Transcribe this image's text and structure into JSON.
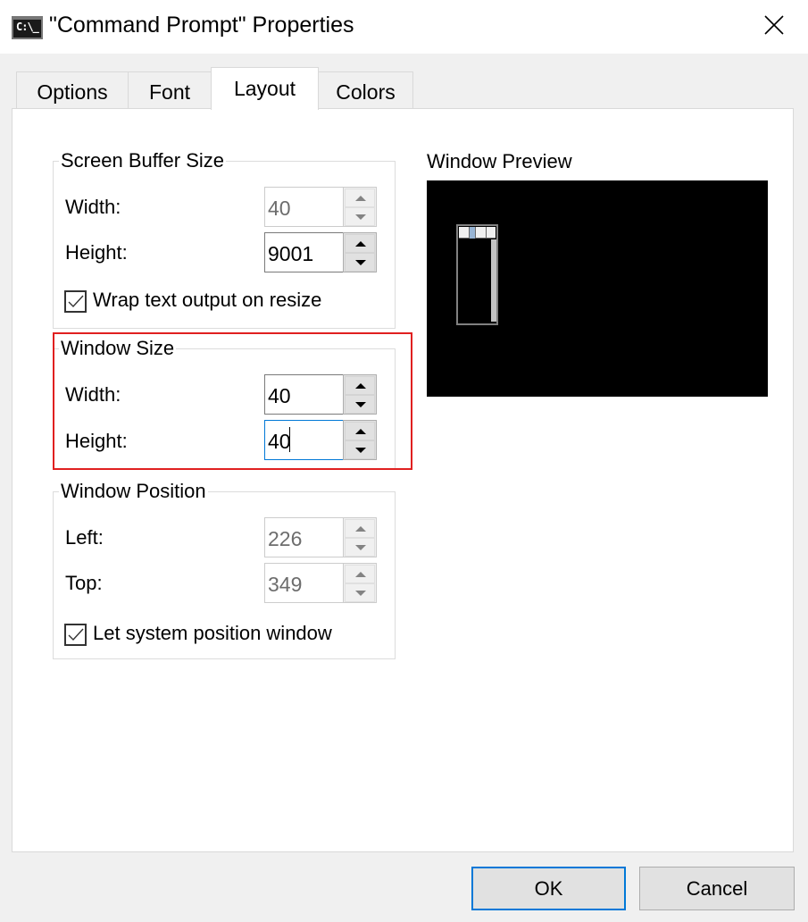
{
  "window": {
    "title": "\"Command Prompt\" Properties",
    "icon": "cmd-icon",
    "icon_text": "C:\\_",
    "close_icon": "close-icon"
  },
  "tabs": [
    {
      "label": "Options",
      "active": false
    },
    {
      "label": "Font",
      "active": false
    },
    {
      "label": "Layout",
      "active": true
    },
    {
      "label": "Colors",
      "active": false
    }
  ],
  "screen_buffer": {
    "title": "Screen Buffer Size",
    "width_label": "Width:",
    "width_value": "40",
    "width_enabled": false,
    "height_label": "Height:",
    "height_value": "9001",
    "height_enabled": true,
    "wrap_label": "Wrap text output on resize",
    "wrap_checked": true
  },
  "window_size": {
    "title": "Window Size",
    "width_label": "Width:",
    "width_value": "40",
    "height_label": "Height:",
    "height_value": "40",
    "focused_field": "height",
    "highlighted": true,
    "highlight_color": "#e02020"
  },
  "window_position": {
    "title": "Window Position",
    "left_label": "Left:",
    "left_value": "226",
    "top_label": "Top:",
    "top_value": "349",
    "fields_enabled": false,
    "system_position_label": "Let system position window",
    "system_position_checked": true
  },
  "preview": {
    "title": "Window Preview",
    "background": "#000000",
    "selection_color": "#97b4d4"
  },
  "buttons": {
    "ok": "OK",
    "cancel": "Cancel",
    "default_border_color": "#0078d7"
  }
}
